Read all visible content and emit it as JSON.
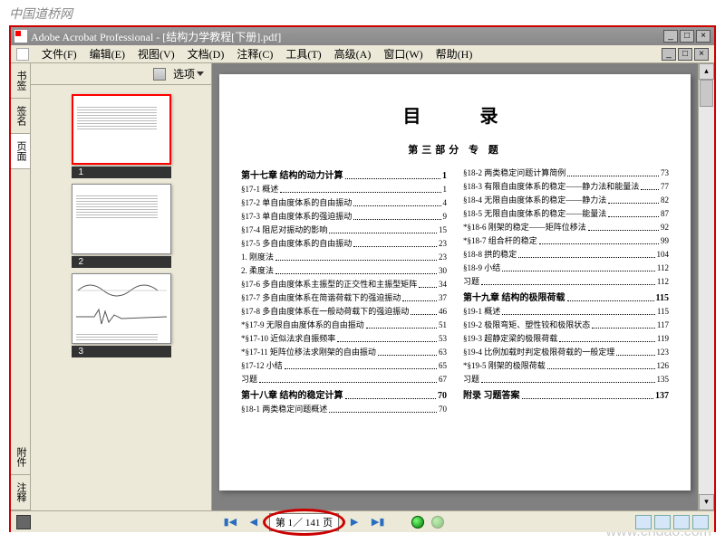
{
  "watermark": {
    "top": "中国道桥网",
    "bottom": "www.cndao.com"
  },
  "window": {
    "title": "Adobe Acrobat Professional - [结构力学教程[下册].pdf]"
  },
  "menu": {
    "file": "文件(F)",
    "edit": "编辑(E)",
    "view": "视图(V)",
    "document": "文档(D)",
    "comment": "注释(C)",
    "tool": "工具(T)",
    "advanced": "高级(A)",
    "window": "窗口(W)",
    "help": "帮助(H)"
  },
  "sidetabs": {
    "bookmark": "书签",
    "signature": "签名",
    "pages": "页面",
    "attachment": "附件",
    "comment": "注释"
  },
  "thumb": {
    "options": "选项",
    "p1": "1",
    "p2": "2",
    "p3": "3"
  },
  "toc": {
    "title": "目 录",
    "section": "第三部分  专  题",
    "left": [
      {
        "t": "chap",
        "l": "第十七章  结构的动力计算",
        "p": "1"
      },
      {
        "t": "e",
        "l": "§17-1  概述",
        "p": "1"
      },
      {
        "t": "e",
        "l": "§17-2  单自由度体系的自由振动",
        "p": "4"
      },
      {
        "t": "e",
        "l": "§17-3  单自由度体系的强迫振动",
        "p": "9"
      },
      {
        "t": "e",
        "l": "§17-4  阻尼对振动的影响",
        "p": "15"
      },
      {
        "t": "e",
        "l": "§17-5  多自由度体系的自由振动",
        "p": "23"
      },
      {
        "t": "e",
        "l": "  1. 刚度法",
        "p": "23"
      },
      {
        "t": "e",
        "l": "  2. 柔度法",
        "p": "30"
      },
      {
        "t": "e",
        "l": "§17-6  多自由度体系主振型的正交性和主振型矩阵",
        "p": "34"
      },
      {
        "t": "e",
        "l": "§17-7  多自由度体系在简谐荷载下的强迫振动",
        "p": "37"
      },
      {
        "t": "e",
        "l": "§17-8  多自由度体系在一般动荷载下的强迫振动",
        "p": "46"
      },
      {
        "t": "e",
        "l": "*§17-9  无限自由度体系的自由振动",
        "p": "51"
      },
      {
        "t": "e",
        "l": "*§17-10  近似法求自振频率",
        "p": "53"
      },
      {
        "t": "e",
        "l": "*§17-11  矩阵位移法求刚架的自由振动",
        "p": "63"
      },
      {
        "t": "e",
        "l": "§17-12  小结",
        "p": "65"
      },
      {
        "t": "e",
        "l": "  习题",
        "p": "67"
      },
      {
        "t": "chap",
        "l": "第十八章  结构的稳定计算",
        "p": "70"
      },
      {
        "t": "e",
        "l": "§18-1  两类稳定问题概述",
        "p": "70"
      }
    ],
    "right": [
      {
        "t": "e",
        "l": "§18-2  两类稳定问题计算简例",
        "p": "73"
      },
      {
        "t": "e",
        "l": "§18-3  有限自由度体系的稳定——静力法和能量法",
        "p": "77"
      },
      {
        "t": "e",
        "l": "§18-4  无限自由度体系的稳定——静力法",
        "p": "82"
      },
      {
        "t": "e",
        "l": "§18-5  无限自由度体系的稳定——能量法",
        "p": "87"
      },
      {
        "t": "e",
        "l": "*§18-6  刚架的稳定——矩阵位移法",
        "p": "92"
      },
      {
        "t": "e",
        "l": "*§18-7  组合杆的稳定",
        "p": "99"
      },
      {
        "t": "e",
        "l": "§18-8  拱的稳定",
        "p": "104"
      },
      {
        "t": "e",
        "l": "§18-9  小结",
        "p": "112"
      },
      {
        "t": "e",
        "l": "  习题",
        "p": "112"
      },
      {
        "t": "chap",
        "l": "第十九章  结构的极限荷载",
        "p": "115"
      },
      {
        "t": "e",
        "l": "§19-1  概述",
        "p": "115"
      },
      {
        "t": "e",
        "l": "§19-2  极限弯矩、塑性铰和极限状态",
        "p": "117"
      },
      {
        "t": "e",
        "l": "§19-3  超静定梁的极限荷载",
        "p": "119"
      },
      {
        "t": "e",
        "l": "§19-4  比例加载时判定极限荷载的一般定理",
        "p": "123"
      },
      {
        "t": "e",
        "l": "*§19-5  刚架的极限荷载",
        "p": "126"
      },
      {
        "t": "e",
        "l": "  习题",
        "p": "135"
      },
      {
        "t": "chap",
        "l": "附录  习题答案",
        "p": "137"
      }
    ]
  },
  "status": {
    "page": "第 1／ 141 页"
  }
}
